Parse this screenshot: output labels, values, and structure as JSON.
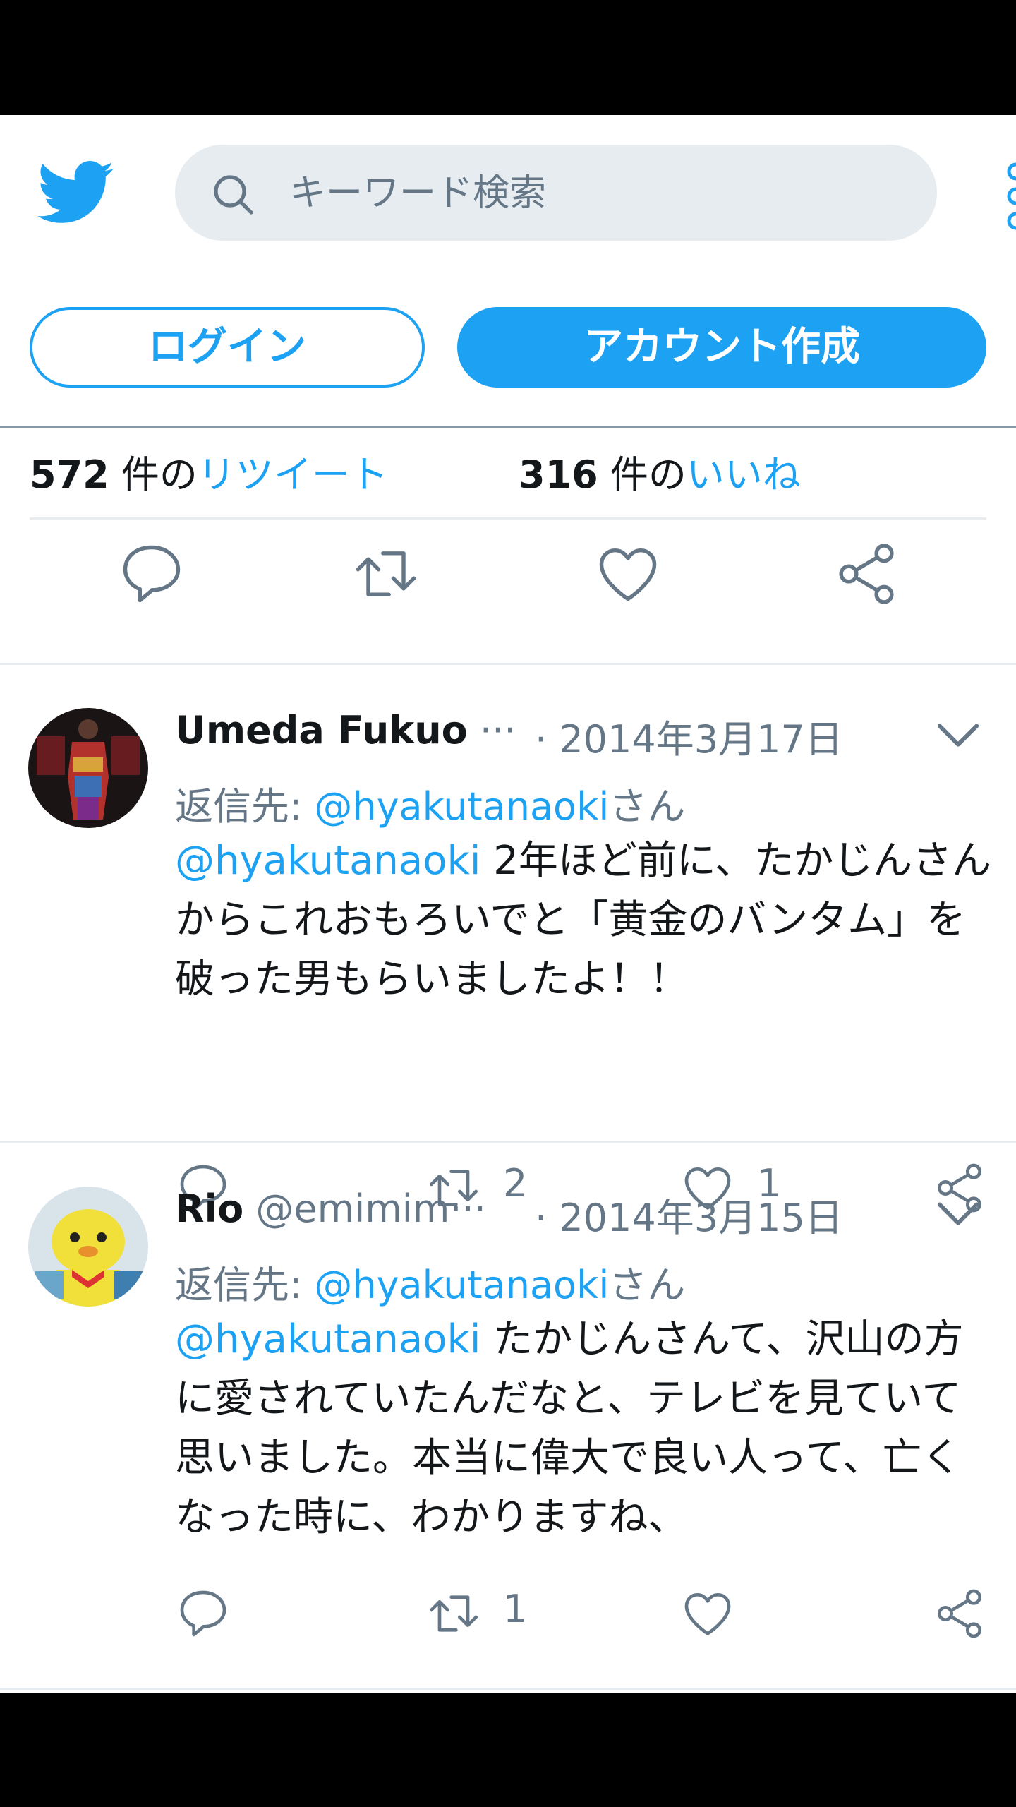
{
  "search": {
    "placeholder": "キーワード検索"
  },
  "header": {
    "login_label": "ログイン",
    "signup_label": "アカウント作成"
  },
  "stats": {
    "retweets_count": "572",
    "retweets_unit": "件の",
    "retweets_label": "リツイート",
    "likes_count": "316",
    "likes_unit": "件の",
    "likes_label": "いいね"
  },
  "colors": {
    "accent": "#1da1f2",
    "muted": "#657786",
    "divider": "#e6ecf0"
  },
  "tweets": [
    {
      "name": "Umeda Fukuo",
      "handle": "···",
      "date": "· 2014年3月17日",
      "reply_prefix": "返信先: ",
      "reply_handle": "@hyakutanaoki",
      "reply_suffix": "さん",
      "mention": "@hyakutanaoki",
      "text": " 2年ほど前に、たかじんさんからこれおもろいでと「黄金のバンタム」を破った男もらいましたよ！！",
      "retweets": "2",
      "likes": "1"
    },
    {
      "name": "Rio",
      "handle": "@emimim···",
      "date": "· 2014年3月15日",
      "reply_prefix": "返信先: ",
      "reply_handle": "@hyakutanaoki",
      "reply_suffix": "さん",
      "mention": "@hyakutanaoki",
      "text": " たかじんさんて、沢山の方に愛されていたんだなと、テレビを見ていて思いました。本当に偉大で良い人って、亡くなった時に、わかりますね、",
      "retweets": "1",
      "likes": ""
    }
  ]
}
